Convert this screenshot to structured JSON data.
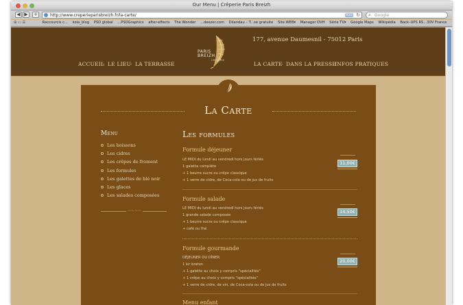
{
  "window": {
    "title": "Our Menu | Crêperie Paris Breizh"
  },
  "toolbar": {
    "back": "◀",
    "forward": "▶",
    "add": "+",
    "url": "http://www.creperieparisbreizh.fr/la-carte/",
    "rss_label": "RSS",
    "reload": "↻",
    "search_placeholder": "Google"
  },
  "bookmarks": [
    "Raccourcis c...",
    "kola_blog",
    "PSD global",
    "...PSDGraphics",
    "after-effects",
    "The Wonder",
    "...deezer.com",
    "Dilandau – T...se gratuite",
    "Site WEB▾",
    "Manager OVH",
    "Série TV▾",
    "Google Maps",
    "Wikipédia",
    "Back–UPS RS...30V France"
  ],
  "header": {
    "address": "177, avenue Daumesnil - 75012 Paris",
    "nav_left": [
      "ACCUEIL",
      "LE LIEU",
      "LA TERRASSE"
    ],
    "nav_right": [
      "LA CARTE",
      "DANS LA PRESSE",
      "INFOS PRATIQUES"
    ],
    "sep": "·",
    "logo_line1": "PARIS",
    "logo_line2": "BREIZH",
    "logo_line3": "CRÊPERIE"
  },
  "page": {
    "title": "La Carte"
  },
  "menu": {
    "heading": "Menu",
    "items": [
      "Les boissons",
      "Les cidres",
      "Les crêpes de froment",
      "Les formules",
      "Les galettes de blé noir",
      "Les glaces",
      "Les salades composées"
    ],
    "ornament": "~~~~"
  },
  "section": {
    "heading": "Les formules"
  },
  "formules": [
    {
      "name": "Formule déjeuner",
      "lines": [
        "LE MIDI du lundi au vendredi hors jours fériés",
        "1 galette complète",
        "+ 1 beurre sucre ou crêpe classique",
        "+ 1 verre de cidre, de Coca-cola ou de jus de fruits"
      ],
      "price": "11,00€"
    },
    {
      "name": "Formule salade",
      "lines": [
        "LE MIDI du lundi au vendredi hors jours fériés",
        "1 grande salade composée",
        "+ 1 beurre sucre ou crêpe classique",
        "+ café ou thé"
      ],
      "price": "14,50€"
    },
    {
      "name": "Formule gourmande",
      "lines": [
        "DÉJEUNER OU DÎNER",
        "1 kir breton",
        "+ 1 galette au choix y compris \"spécialités\"",
        "+ 1 crêpe au choix y compris \"spécialités\"",
        "+ 1 verre de cidre, de vin, de Coca-cola ou de jus de fruits"
      ],
      "price": "20,00€"
    },
    {
      "name": "Menu enfant",
      "lines": [],
      "price": ""
    }
  ],
  "colors": {
    "header": "#5e3e19",
    "panel": "#7a4d17",
    "background": "#cfb588",
    "price_badge": "#8fb1b1"
  }
}
